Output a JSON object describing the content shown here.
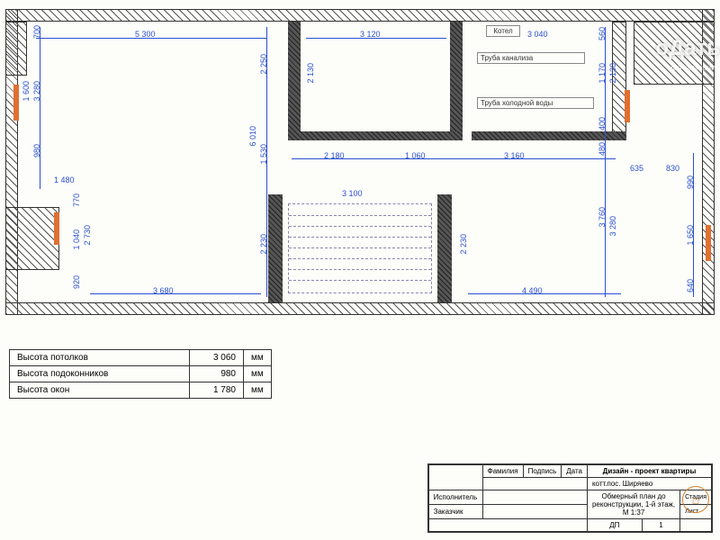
{
  "plan": {
    "outer_border_note": "hatched border frame",
    "dimensions_horizontal": {
      "d5300": "5 300",
      "d3120": "3 120",
      "d3040": "3 040",
      "d2180": "2 180",
      "d1060": "1 060",
      "d3160": "3 160",
      "d635": "635",
      "d830": "830",
      "d1480": "1 480",
      "d3100": "3 100",
      "d3680": "3 680",
      "d4490": "4 490"
    },
    "dimensions_vertical": {
      "d700": "700",
      "d1600": "1 600",
      "d3280a": "3 280",
      "d980": "980",
      "d2250": "2 250",
      "d6010": "6 010",
      "d1530": "1 530",
      "d2130a": "2 130",
      "d560": "560",
      "d2130b": "2 130",
      "d1170": "1 170",
      "d400": "400",
      "d480": "480",
      "d770": "770",
      "d1040": "1 040",
      "d2730": "2 730",
      "d920": "920",
      "d2230a": "2 230",
      "d2230b": "2 230",
      "d3760": "3 760",
      "d3280b": "3 280",
      "d990": "990",
      "d1650": "1 650",
      "d640": "640"
    },
    "notes": {
      "boiler": "Котел",
      "pipe_sewer": "Труба канализа",
      "pipe_cold": "Труба холодной воды"
    }
  },
  "info_table": {
    "rows": [
      {
        "label": "Высота потолков",
        "value": "3 060",
        "unit": "мм"
      },
      {
        "label": "Высота подоконников",
        "value": "980",
        "unit": "мм"
      },
      {
        "label": "Высота окон",
        "value": "1 780",
        "unit": "мм"
      }
    ]
  },
  "title_block": {
    "header_project": "Дизайн - проект квартиры",
    "col_family": "Фамилия",
    "col_sign": "Подпись",
    "col_date": "Дата",
    "address": "котт.пос. Ширяево",
    "drawing_title_1": "Обмерный план до",
    "drawing_title_2": "реконструкции, 1-й этаж,",
    "drawing_scale": "М 1:37",
    "row_executor": "Исполнитель",
    "row_client": "Заказчик",
    "col_stage": "Стадия",
    "col_sheet": "Лист",
    "val_stage": "ДП",
    "val_sheet": "1"
  },
  "watermark": {
    "main": "оДать",
    "sub": "ная компания"
  }
}
